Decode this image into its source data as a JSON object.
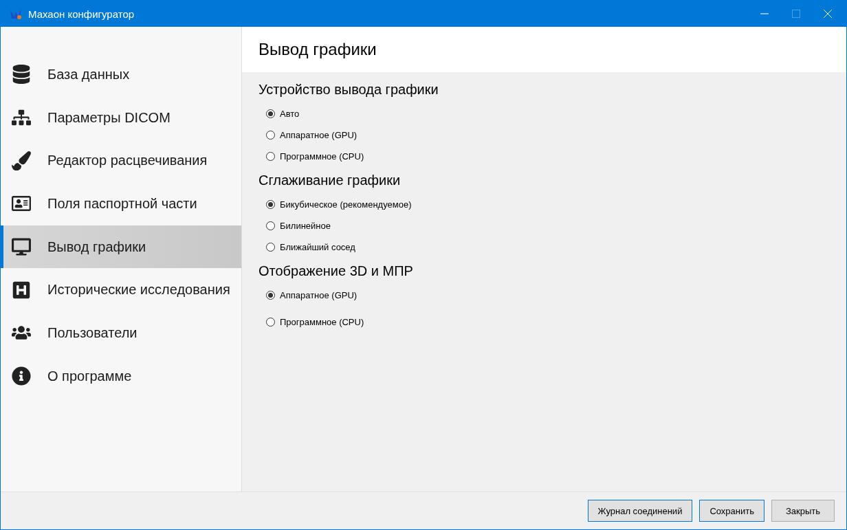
{
  "window": {
    "title": "Махаон конфигуратор",
    "maximize_disabled": true
  },
  "sidebar": {
    "items": [
      {
        "label": "База данных",
        "selected": false
      },
      {
        "label": "Параметры DICOM",
        "selected": false
      },
      {
        "label": "Редактор расцвечивания",
        "selected": false
      },
      {
        "label": "Поля паспортной части",
        "selected": false
      },
      {
        "label": "Вывод графики",
        "selected": true
      },
      {
        "label": "Исторические исследования",
        "selected": false
      },
      {
        "label": "Пользователи",
        "selected": false
      },
      {
        "label": "О программе",
        "selected": false
      }
    ]
  },
  "page": {
    "title": "Вывод графики",
    "groups": [
      {
        "title": "Устройство вывода графики",
        "options": [
          {
            "label": "Авто",
            "selected": true
          },
          {
            "label": "Аппаратное (GPU)",
            "selected": false
          },
          {
            "label": "Программное (CPU)",
            "selected": false
          }
        ]
      },
      {
        "title": "Сглаживание графики",
        "options": [
          {
            "label": "Бикубическое (рекомендуемое)",
            "selected": true
          },
          {
            "label": "Билинейное",
            "selected": false
          },
          {
            "label": "Ближайший сосед",
            "selected": false
          }
        ]
      },
      {
        "title": "Отображение 3D и МПР",
        "options": [
          {
            "label": "Аппаратное (GPU)",
            "selected": true
          },
          {
            "label": "Программное (CPU)",
            "selected": false
          }
        ]
      }
    ]
  },
  "buttons": [
    {
      "label": "Журнал соединений",
      "highlighted": true
    },
    {
      "label": "Сохранить",
      "highlighted": true
    },
    {
      "label": "Закрыть",
      "highlighted": false
    }
  ]
}
